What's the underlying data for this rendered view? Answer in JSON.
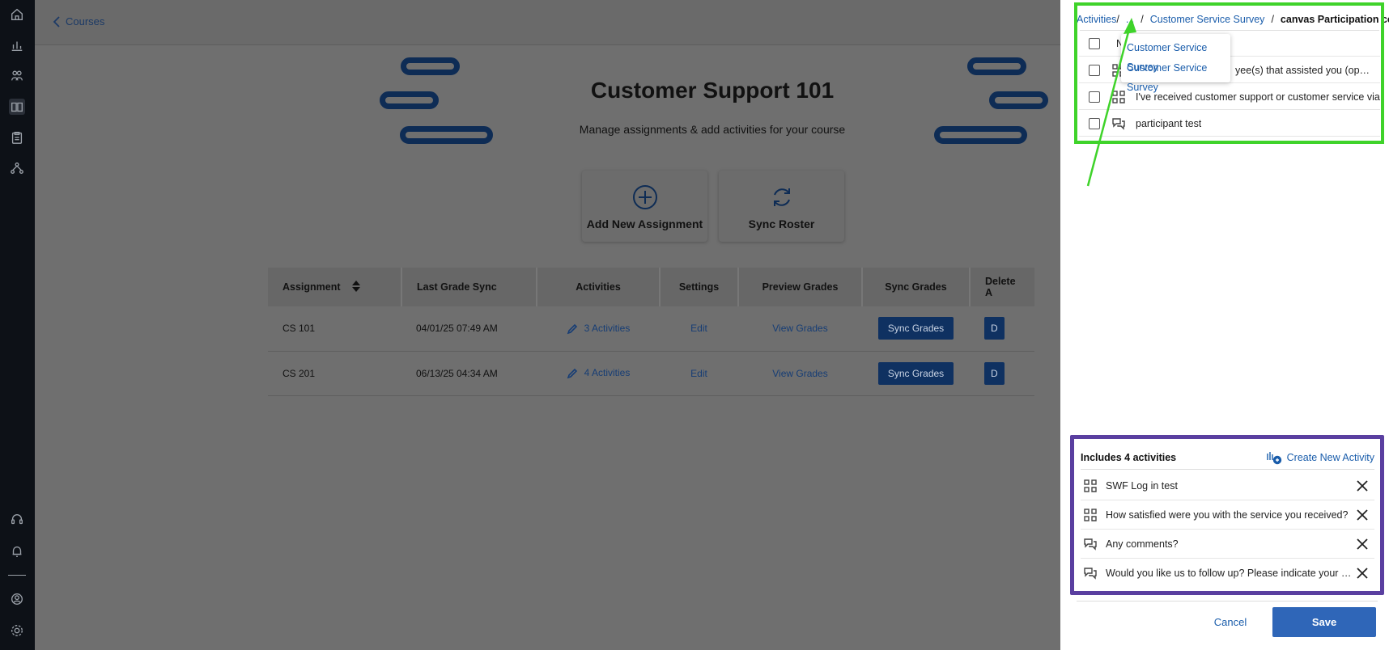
{
  "colors": {
    "accent": "#1a5dab",
    "highlight_green": "#3fd32a",
    "highlight_purple": "#5a3fa0",
    "nav_bg": "#0d1117",
    "save_bg": "#2f66b8"
  },
  "nav": {
    "icons": [
      "home-icon",
      "analytics-icon",
      "users-icon",
      "courses-icon",
      "clipboard-icon",
      "network-icon",
      "support-icon",
      "bell-icon",
      "profile-icon",
      "settings-icon"
    ]
  },
  "header": {
    "back_label": "Courses"
  },
  "course": {
    "title": "Customer Support 101",
    "subtitle": "Manage assignments & add activities for your course"
  },
  "actions": {
    "add_assignment": "Add New Assignment",
    "sync_roster": "Sync Roster"
  },
  "table": {
    "headers": [
      "Assignment",
      "Last Grade Sync",
      "Activities",
      "Settings",
      "Preview Grades",
      "Sync Grades",
      "Delete A"
    ],
    "rows": [
      {
        "assignment": "CS 101",
        "last_sync": "04/01/25 07:49 AM",
        "activities": "3 Activities",
        "settings": "Edit",
        "preview": "View Grades",
        "sync": "Sync Grades",
        "delete": "D"
      },
      {
        "assignment": "CS 201",
        "last_sync": "06/13/25 04:34 AM",
        "activities": "4 Activities",
        "settings": "Edit",
        "preview": "View Grades",
        "sync": "Sync Grades",
        "delete": "D"
      }
    ]
  },
  "panel": {
    "breadcrumb": {
      "root": "Activities",
      "ellipsis": "...",
      "parent": "Customer Service Survey",
      "current": "canvas Participation copy"
    },
    "dropdown": [
      "Customer Service Survey",
      "Customer Service Survey"
    ],
    "list": [
      {
        "text": "Na",
        "icon": ""
      },
      {
        "text": "yee(s) that assisted you (op…",
        "icon": "qr-grid-icon"
      },
      {
        "text": "I've received customer support or customer service via",
        "icon": "qr-grid-icon"
      },
      {
        "text": "participant test",
        "icon": "chat-bubbles-icon"
      }
    ],
    "includes": {
      "title": "Includes 4 activities",
      "create_label": "Create New Activity",
      "items": [
        {
          "text": "SWF Log in test",
          "icon": "qr-grid-icon"
        },
        {
          "text": "How satisfied were you with the service you received?",
          "icon": "qr-grid-icon"
        },
        {
          "text": "Any comments?",
          "icon": "chat-bubbles-icon"
        },
        {
          "text": "Would you like us to follow up? Please indicate your pr…",
          "icon": "chat-bubbles-icon"
        }
      ]
    },
    "cancel_label": "Cancel",
    "save_label": "Save"
  }
}
